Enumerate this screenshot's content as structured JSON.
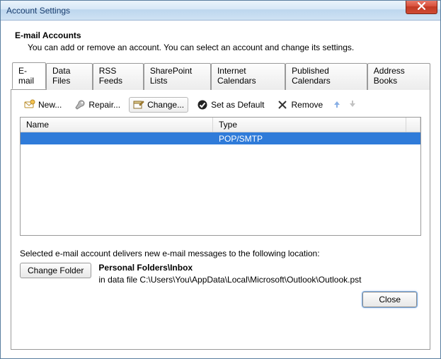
{
  "window": {
    "title": "Account Settings"
  },
  "header": {
    "title": "E-mail Accounts",
    "desc": "You can add or remove an account. You can select an account and change its settings."
  },
  "tabs": [
    {
      "label": "E-mail",
      "active": true
    },
    {
      "label": "Data Files"
    },
    {
      "label": "RSS Feeds"
    },
    {
      "label": "SharePoint Lists"
    },
    {
      "label": "Internet Calendars"
    },
    {
      "label": "Published Calendars"
    },
    {
      "label": "Address Books"
    }
  ],
  "toolbar": {
    "new": "New...",
    "repair": "Repair...",
    "change": "Change...",
    "set_default": "Set as Default",
    "remove": "Remove"
  },
  "list": {
    "columns": {
      "name": "Name",
      "type": "Type"
    },
    "rows": [
      {
        "name": "",
        "type": "POP/SMTP",
        "selected": true
      }
    ]
  },
  "delivery": {
    "intro": "Selected e-mail account delivers new e-mail messages to the following location:",
    "change_folder": "Change Folder",
    "location_title": "Personal Folders\\Inbox",
    "location_path": "in data file C:\\Users\\You\\AppData\\Local\\Microsoft\\Outlook\\Outlook.pst"
  },
  "footer": {
    "close": "Close"
  }
}
